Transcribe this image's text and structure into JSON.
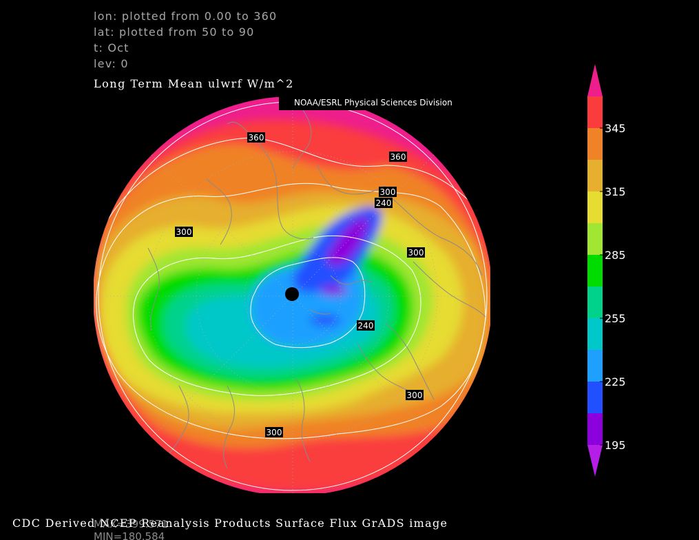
{
  "meta": {
    "lon": "lon: plotted from 0.00 to 360",
    "lat": "lat: plotted from 50 to 90",
    "t": "t: Oct",
    "lev": "lev: 0"
  },
  "title": "Long Term Mean ulwrf W/m^2",
  "credit_box": "NOAA/ESRL Physical Sciences Division",
  "footer": {
    "max_text": "MAX=399.571",
    "min_text": "MIN=180.584",
    "credit": "CDC Derived NCEP Reanalysis Products Surface Flux GrADS image"
  },
  "colorbar": {
    "labels": [
      "345",
      "315",
      "285",
      "255",
      "225",
      "195"
    ],
    "colors": [
      "#ee1e8c",
      "#fa3c3c",
      "#f08228",
      "#e6af2d",
      "#e6dc32",
      "#a0e632",
      "#00dc00",
      "#00d28c",
      "#00c8c8",
      "#1ea0ff",
      "#2050ff",
      "#8c00dc",
      "#b41ee6"
    ]
  },
  "contour_labels": [
    "360",
    "360",
    "300",
    "240",
    "300",
    "300",
    "240",
    "300",
    "300"
  ],
  "pole_marker": "north-pole-dot"
}
